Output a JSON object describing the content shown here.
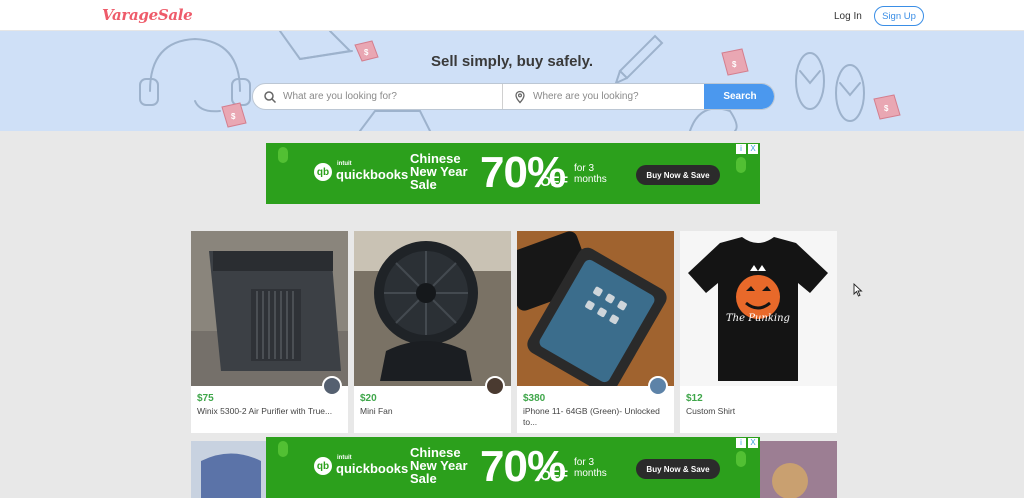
{
  "header": {
    "logo_text": "VarageSale",
    "login_label": "Log In",
    "signup_label": "Sign Up"
  },
  "hero": {
    "tagline": "Sell simply, buy safely.",
    "search": {
      "what_placeholder": "What are you looking for?",
      "where_placeholder": "Where are you looking?",
      "button_label": "Search"
    }
  },
  "ads": [
    {
      "brand_small": "intuit",
      "brand": "quickbooks",
      "headline": "Chinese New Year Sale",
      "percent": "70%",
      "off": "OFF",
      "duration": "for 3 months",
      "cta": "Buy Now & Save",
      "adchoices": [
        "i",
        "X"
      ]
    },
    {
      "brand_small": "intuit",
      "brand": "quickbooks",
      "headline": "Chinese New Year Sale",
      "percent": "70%",
      "off": "OFF",
      "duration": "for 3 months",
      "cta": "Buy Now & Save",
      "adchoices": [
        "i",
        "X"
      ]
    }
  ],
  "listings": [
    {
      "price": "$75",
      "title": "Winix 5300-2 Air Purifier with True..."
    },
    {
      "price": "$20",
      "title": "Mini Fan"
    },
    {
      "price": "$380",
      "title": "iPhone 11- 64GB (Green)- Unlocked to..."
    },
    {
      "price": "$12",
      "title": "Custom Shirt",
      "shirt_text": "The Punking"
    }
  ],
  "colors": {
    "brand": "#ee5b6a",
    "accent": "#4b98ee",
    "price": "#3fa64a",
    "hero_bg": "#cfe0f7",
    "ad_bg": "#2ca01c"
  }
}
